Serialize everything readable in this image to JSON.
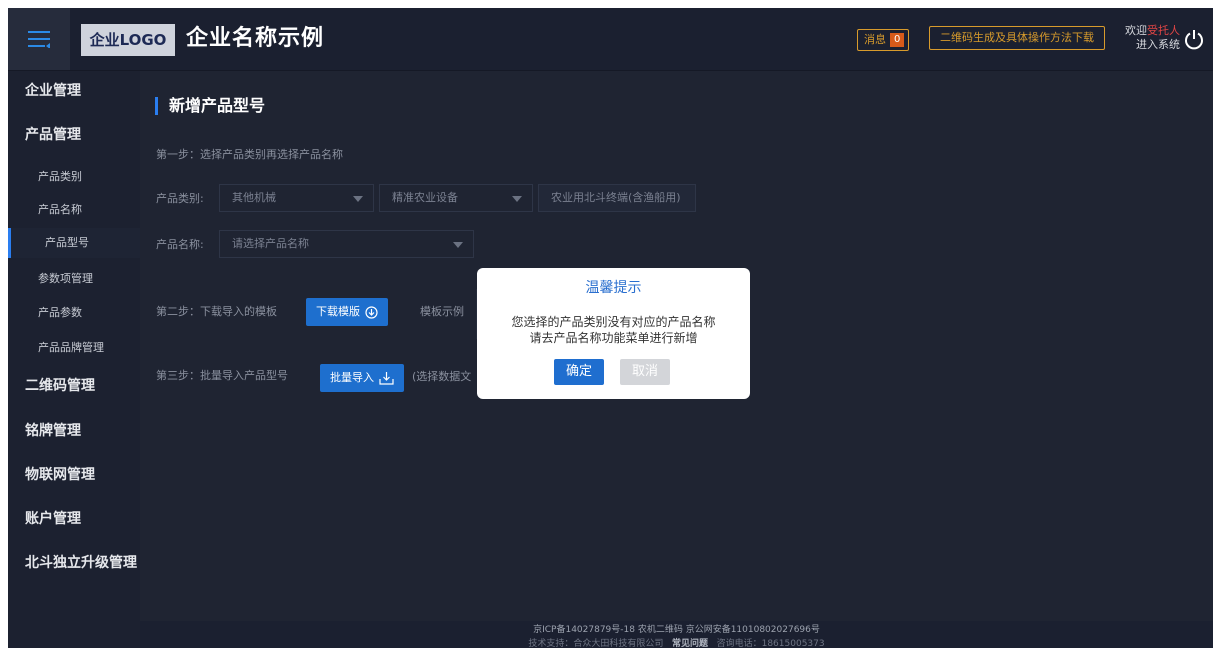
{
  "header": {
    "logo_text": "企业LOGO",
    "company_name": "企业名称示例",
    "message_label": "消息",
    "message_count": "0",
    "qr_help_label": "二维码生成及具体操作方法下载",
    "welcome_prefix": "欢迎",
    "welcome_user": "受托人",
    "enter_system": "进入系统",
    "icons": [
      "menu-icon",
      "power-icon"
    ]
  },
  "sidebar": {
    "enterprise": "企业管理",
    "product": "产品管理",
    "product_category": "产品类别",
    "product_name": "产品名称",
    "product_model": "产品型号",
    "param_items": "参数项管理",
    "product_params": "产品参数",
    "product_brand": "产品品牌管理",
    "qrcode": "二维码管理",
    "nameplate": "铭牌管理",
    "iot": "物联网管理",
    "account": "账户管理",
    "beidou": "北斗独立升级管理"
  },
  "main": {
    "title": "新增产品型号",
    "step1": "第一步：选择产品类别再选择产品名称",
    "category_label": "产品类别:",
    "category_select1": "其他机械",
    "category_select2": "精准农业设备",
    "category_select3": "农业用北斗终端(含渔船用)",
    "name_label": "产品名称:",
    "name_placeholder": "请选择产品名称",
    "step2": "第二步：下载导入的模板",
    "download_btn": "下载模版",
    "sample_label": "模板示例",
    "step3": "第三步：批量导入产品型号",
    "import_btn": "批量导入",
    "import_hint": "(选择数据文"
  },
  "modal": {
    "title": "温馨提示",
    "line1": "您选择的产品类别没有对应的产品名称",
    "line2": "请去产品名称功能菜单进行新增",
    "ok": "确定",
    "cancel": "取消"
  },
  "footer": {
    "line1": "京ICP备14027879号-18 农机二维码 京公网安备11010802027696号",
    "line2_prefix": "技术支持：合众大田科技有限公司",
    "line2_faq": "常见问题",
    "line2_phone": "咨询电话：18615005373"
  },
  "colors": {
    "accent": "#1e6fce",
    "warning": "#d89b2c",
    "background": "#1f2432"
  }
}
